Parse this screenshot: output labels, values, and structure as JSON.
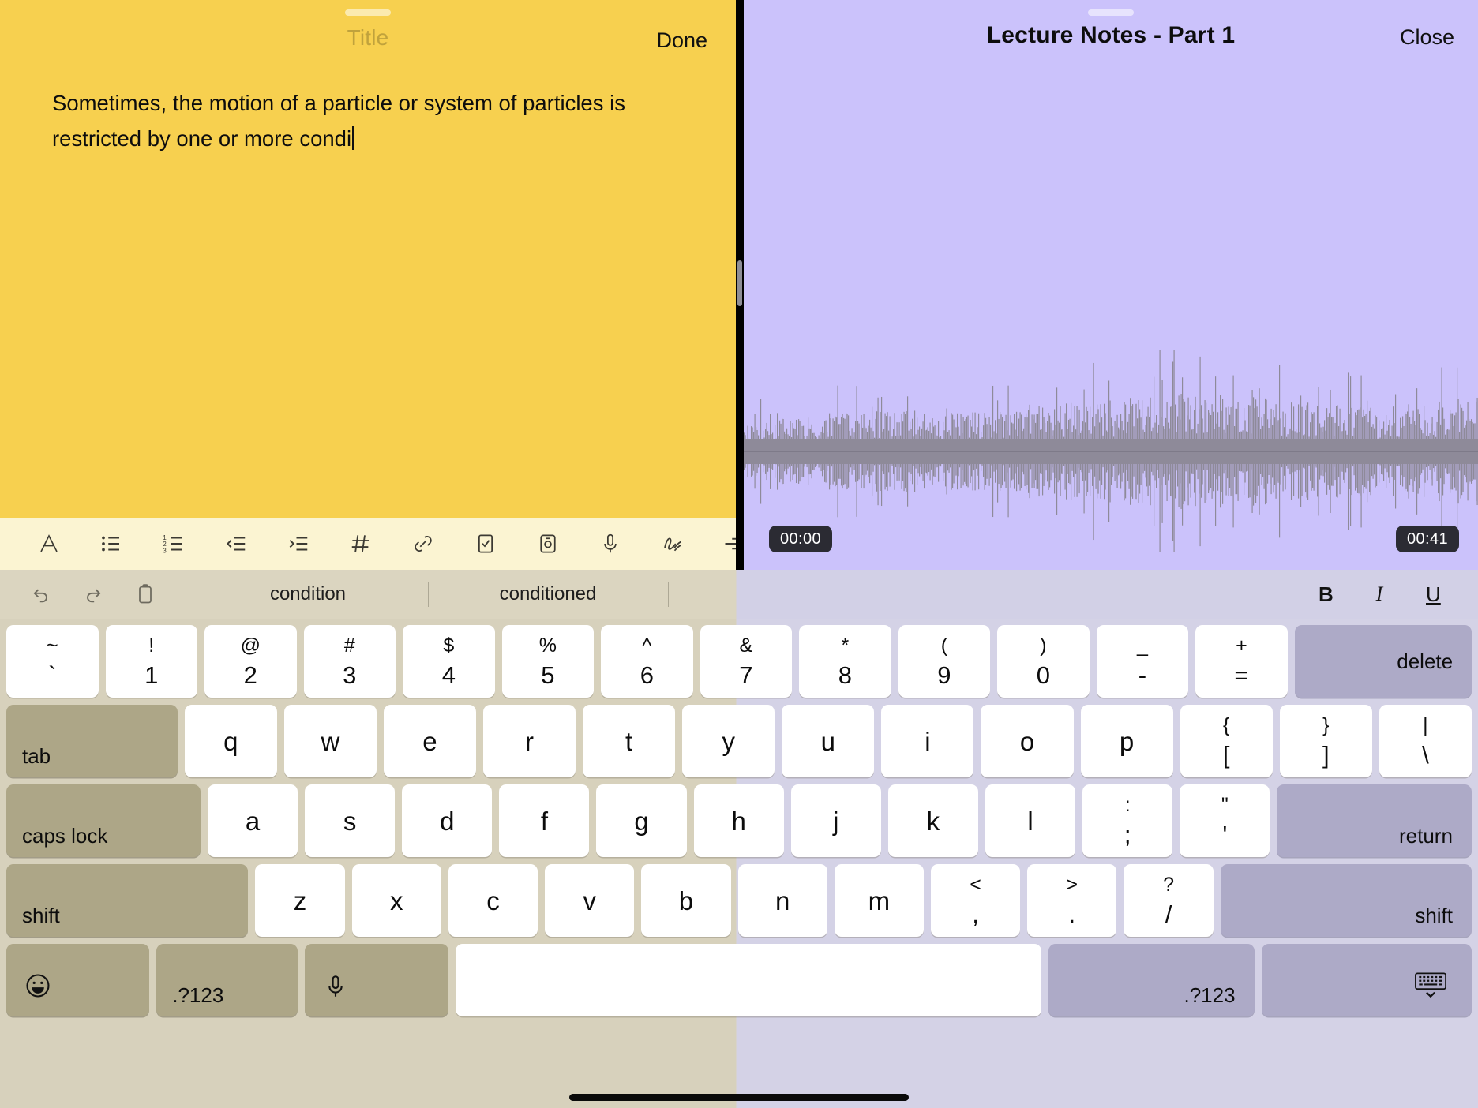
{
  "notes_pane": {
    "title_placeholder": "Title",
    "done_label": "Done",
    "body_text": "Sometimes, the motion of a particle or system of particles is restricted by one or more condi",
    "background_color": "#f7d04f",
    "toolbar": [
      {
        "name": "text-format-icon",
        "label": "A"
      },
      {
        "name": "bulleted-list-icon",
        "label": "Bulleted list"
      },
      {
        "name": "numbered-list-icon",
        "label": "Numbered list"
      },
      {
        "name": "outdent-icon",
        "label": "Outdent"
      },
      {
        "name": "indent-icon",
        "label": "Indent"
      },
      {
        "name": "hashtag-icon",
        "label": "Tag"
      },
      {
        "name": "link-icon",
        "label": "Link"
      },
      {
        "name": "checkbox-icon",
        "label": "Checklist"
      },
      {
        "name": "camera-icon",
        "label": "Camera"
      },
      {
        "name": "microphone-icon",
        "label": "Record audio"
      },
      {
        "name": "scribble-icon",
        "label": "Handwriting"
      },
      {
        "name": "more-lines-icon",
        "label": "More"
      }
    ]
  },
  "audio_pane": {
    "title": "Lecture Notes - Part 1",
    "close_label": "Close",
    "background_color": "#cbc2fb",
    "waveform_color": "#8e8a99",
    "time_start": "00:00",
    "time_end": "00:41"
  },
  "suggestion_bar": {
    "left_icons": [
      {
        "name": "undo-icon",
        "label": "Undo"
      },
      {
        "name": "redo-icon",
        "label": "Redo"
      },
      {
        "name": "paste-icon",
        "label": "Paste"
      }
    ],
    "suggestions": [
      "condition",
      "conditioned",
      ""
    ],
    "style_buttons": [
      {
        "name": "bold-button",
        "label": "B"
      },
      {
        "name": "italic-button",
        "label": "I"
      },
      {
        "name": "underline-button",
        "label": "U"
      }
    ]
  },
  "keyboard": {
    "row_number": [
      {
        "top": "~",
        "bot": "`"
      },
      {
        "top": "!",
        "bot": "1"
      },
      {
        "top": "@",
        "bot": "2"
      },
      {
        "top": "#",
        "bot": "3"
      },
      {
        "top": "$",
        "bot": "4"
      },
      {
        "top": "%",
        "bot": "5"
      },
      {
        "top": "^",
        "bot": "6"
      },
      {
        "top": "&",
        "bot": "7"
      },
      {
        "top": "*",
        "bot": "8"
      },
      {
        "top": "(",
        "bot": "9"
      },
      {
        "top": ")",
        "bot": "0"
      },
      {
        "top": "_",
        "bot": "-"
      },
      {
        "top": "+",
        "bot": "="
      }
    ],
    "delete_label": "delete",
    "tab_label": "tab",
    "row_top": [
      "q",
      "w",
      "e",
      "r",
      "t",
      "y",
      "u",
      "i",
      "o",
      "p"
    ],
    "row_top_extra": [
      {
        "top": "{",
        "bot": "["
      },
      {
        "top": "}",
        "bot": "]"
      },
      {
        "top": "|",
        "bot": "\\"
      }
    ],
    "caps_label": "caps lock",
    "row_home": [
      "a",
      "s",
      "d",
      "f",
      "g",
      "h",
      "j",
      "k",
      "l"
    ],
    "row_home_extra": [
      {
        "top": ":",
        "bot": ";"
      },
      {
        "top": "\"",
        "bot": "'"
      }
    ],
    "return_label": "return",
    "shift_left_label": "shift",
    "row_bottom": [
      "z",
      "x",
      "c",
      "v",
      "b",
      "n",
      "m"
    ],
    "row_bottom_extra": [
      {
        "top": "<",
        "bot": ","
      },
      {
        "top": ">",
        "bot": "."
      },
      {
        "top": "?",
        "bot": "/"
      }
    ],
    "shift_right_label": "shift",
    "emoji_label": "emoji-icon",
    "numbers_left_label": ".?123",
    "dictation_label": "microphone-icon",
    "space_label": "",
    "numbers_right_label": ".?123",
    "dismiss_label": "hide-keyboard-icon"
  }
}
